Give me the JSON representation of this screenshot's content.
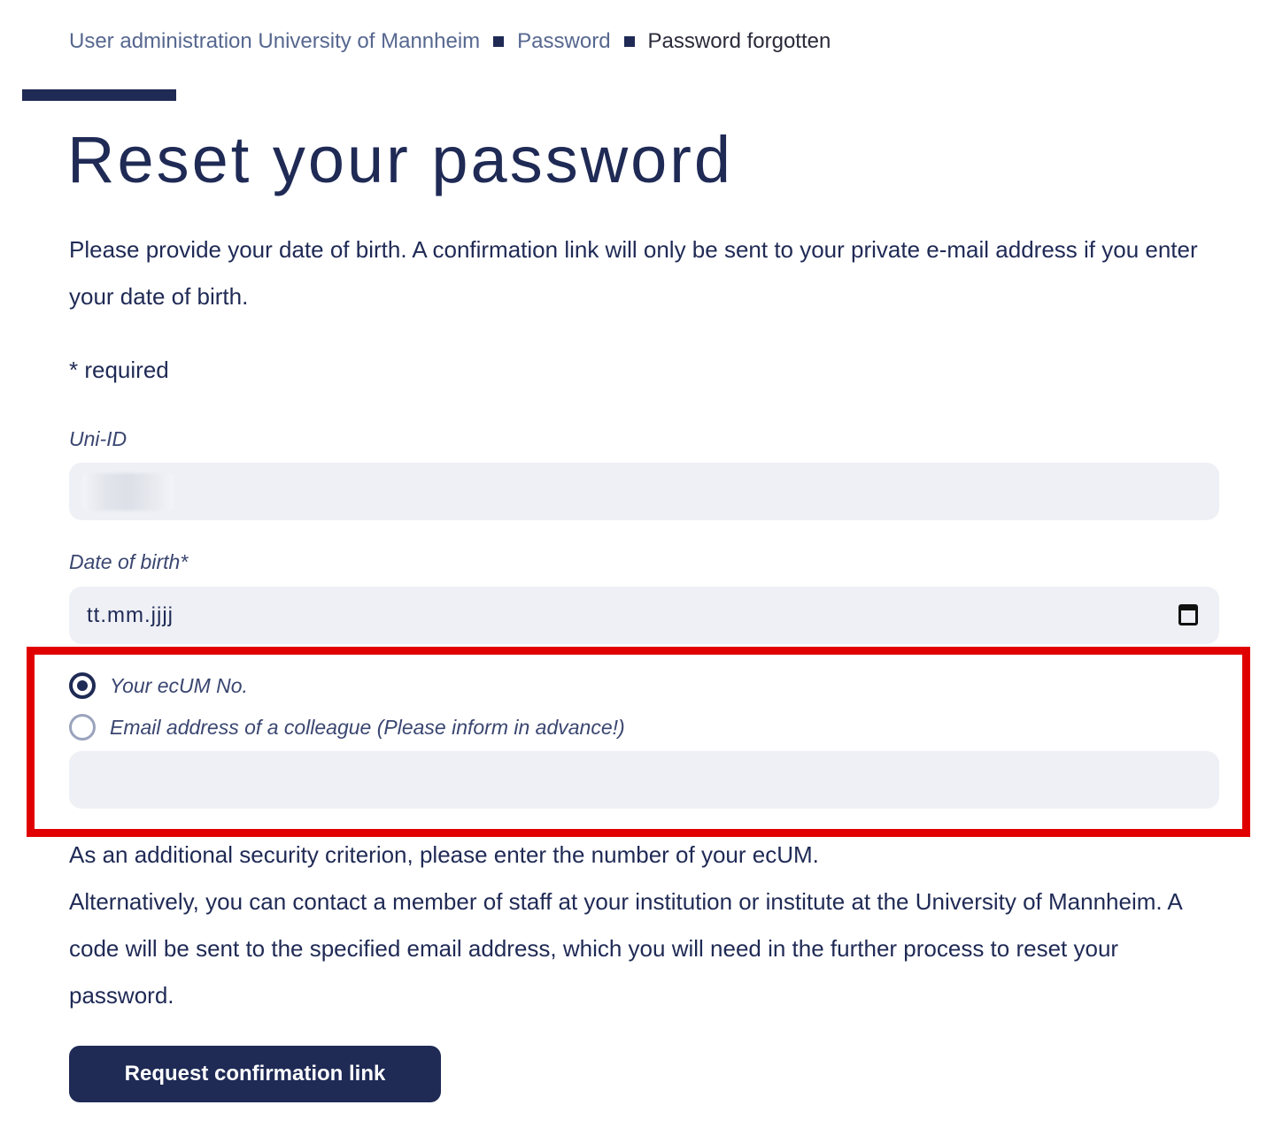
{
  "breadcrumb": {
    "items": [
      "User administration University of Mannheim",
      "Password",
      "Password forgotten"
    ]
  },
  "page": {
    "title": "Reset your password",
    "intro": "Please provide your date of birth. A confirmation link will only be sent to your private e-mail address if you enter your date of birth.",
    "required_note": "* required"
  },
  "form": {
    "uni_id": {
      "label": "Uni-ID",
      "value": ""
    },
    "date_of_birth": {
      "label": "Date of birth*",
      "placeholder": "tt.mm.jjjj"
    },
    "verification": {
      "options": [
        {
          "label": "Your ecUM No.",
          "selected": true
        },
        {
          "label": "Email address of a colleague (Please inform in advance!)",
          "selected": false
        }
      ],
      "value": ""
    },
    "security_text_1": "As an additional security criterion, please enter the number of your ecUM.",
    "security_text_2": "Alternatively, you can contact a member of staff at your institution or institute at the University of Mannheim. A code will be sent to the specified email address, which you will need in the further process to reset your password.",
    "submit_label": "Request confirmation link"
  },
  "colors": {
    "primary": "#1f2a55",
    "field_background": "#eef0f5",
    "highlight": "#e00000"
  }
}
